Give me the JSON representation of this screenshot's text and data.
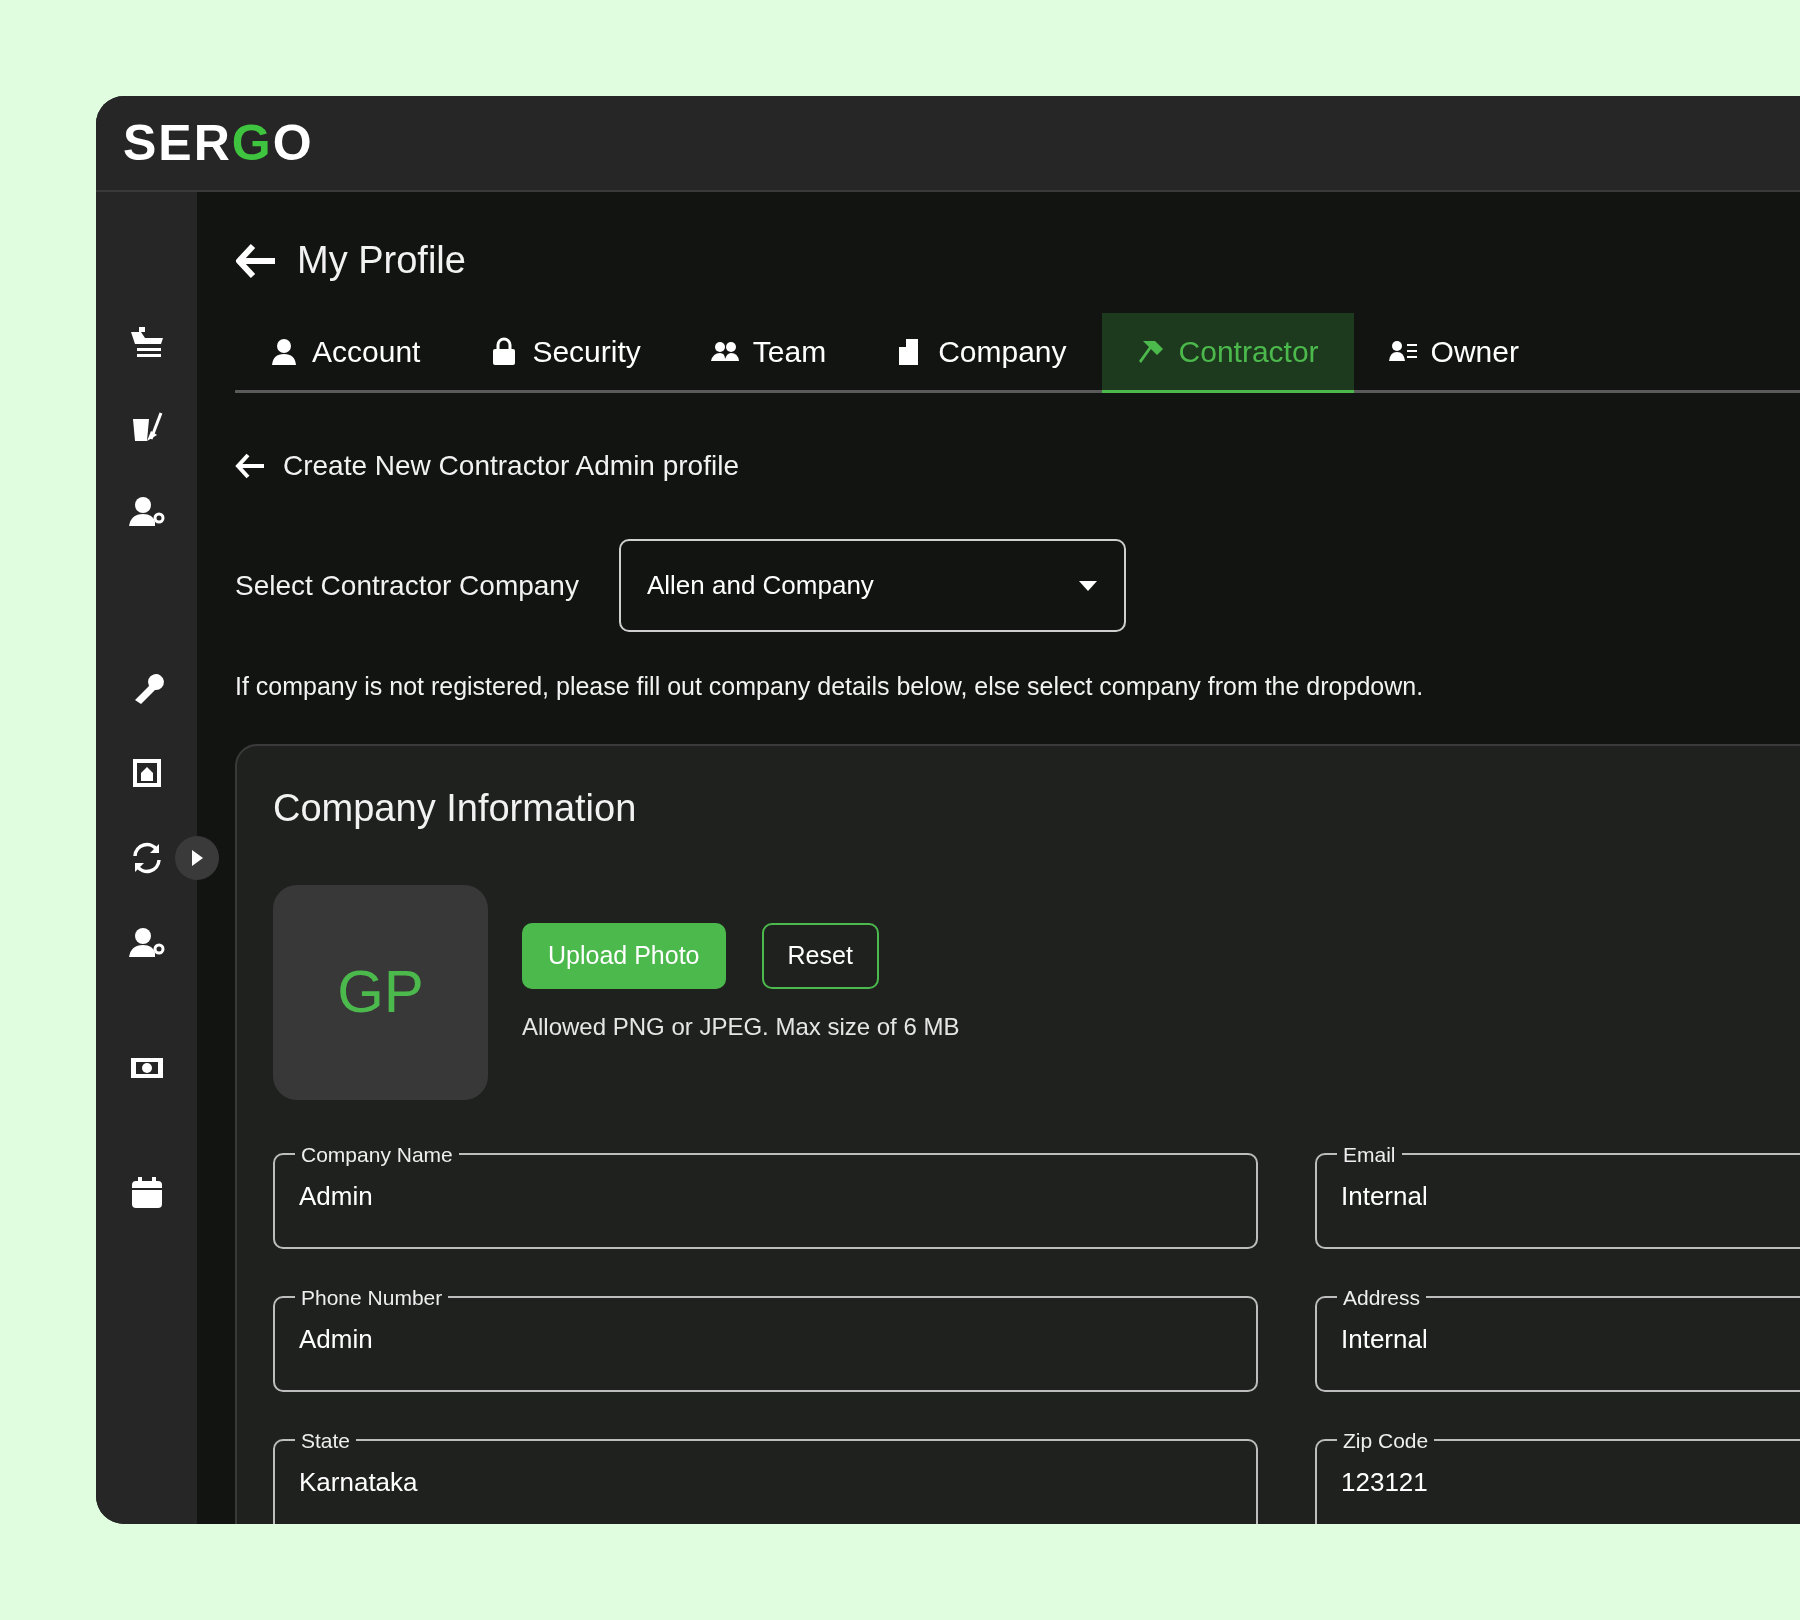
{
  "logo": {
    "parts": [
      {
        "text": "SER",
        "accent": false
      },
      {
        "text": "G",
        "accent": true
      },
      {
        "text": "O",
        "accent": false
      }
    ]
  },
  "sidebar": {
    "items": [
      {
        "kind": "ship"
      },
      {
        "kind": "cleaning"
      },
      {
        "kind": "user-gear"
      },
      {
        "kind": "gap"
      },
      {
        "kind": "wrench"
      },
      {
        "kind": "building"
      },
      {
        "kind": "sync"
      },
      {
        "kind": "user-gear"
      },
      {
        "kind": "space"
      },
      {
        "kind": "money"
      },
      {
        "kind": "space"
      },
      {
        "kind": "calendar"
      }
    ]
  },
  "page_title": "My Profile",
  "tabs": [
    {
      "label": "Account",
      "selected": false
    },
    {
      "label": "Security",
      "selected": false
    },
    {
      "label": "Team",
      "selected": false
    },
    {
      "label": "Company",
      "selected": false
    },
    {
      "label": "Contractor",
      "selected": true
    },
    {
      "label": "Owner",
      "selected": false
    }
  ],
  "section_title": "Create New Contractor Admin profile",
  "company_select": {
    "label": "Select Contractor Company",
    "value": "Allen and Company"
  },
  "note": "If company is not registered, please fill out company details below, else select company from the dropdown.",
  "card": {
    "title": "Company Information",
    "avatar_initials": "GP",
    "upload_button": "Upload Photo",
    "reset_button": "Reset",
    "hint": "Allowed PNG or JPEG. Max size of 6 MB",
    "fields": [
      {
        "label": "Company Name",
        "value": "Admin"
      },
      {
        "label": "Email",
        "value": "Internal"
      },
      {
        "label": "Phone Number",
        "value": "Admin"
      },
      {
        "label": "Address",
        "value": "Internal"
      },
      {
        "label": "State",
        "value": "Karnataka"
      },
      {
        "label": "Zip Code",
        "value": "123121"
      }
    ]
  }
}
